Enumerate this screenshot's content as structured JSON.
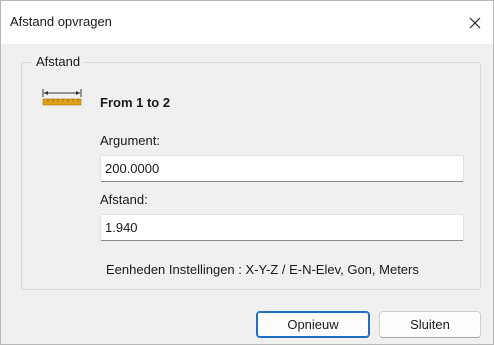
{
  "window": {
    "title": "Afstand opvragen",
    "close_icon": "close-icon"
  },
  "group": {
    "label": "Afstand",
    "icon": "ruler-icon",
    "heading": "From 1 to 2"
  },
  "fields": {
    "argument_label": "Argument:",
    "argument_value": "200.0000",
    "afstand_label": "Afstand:",
    "afstand_value": "1.940"
  },
  "units_text": "Eenheden Instellingen : X-Y-Z / E-N-Elev, Gon, Meters",
  "buttons": {
    "opnieuw": "Opnieuw",
    "sluiten": "Sluiten"
  },
  "colors": {
    "accent": "#1f6fc5",
    "ruler": "#e0a11b"
  }
}
